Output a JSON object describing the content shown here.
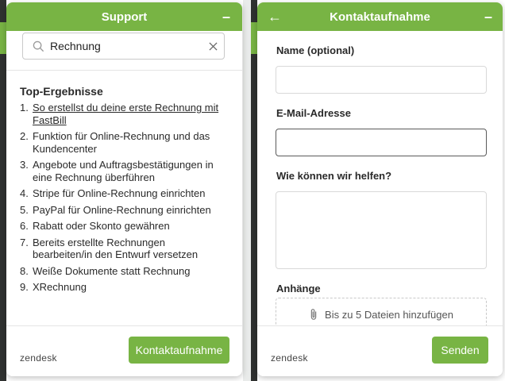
{
  "support_widget": {
    "title": "Support",
    "minimize_symbol": "–",
    "search": {
      "value": "Rechnung",
      "icon": "search-icon",
      "clear_symbol": "×"
    },
    "results_title": "Top-Ergebnisse",
    "results": [
      {
        "number": "1.",
        "text": "So erstellst du deine erste Rechnung mit FastBill"
      },
      {
        "number": "2.",
        "text": "Funktion für Online-Rechnung und das Kundencenter"
      },
      {
        "number": "3.",
        "text": "Angebote und Auftragsbestätigungen in eine Rechnung überführen"
      },
      {
        "number": "4.",
        "text": "Stripe für Online-Rechnung einrichten"
      },
      {
        "number": "5.",
        "text": "PayPal für Online-Rechnung einrichten"
      },
      {
        "number": "6.",
        "text": "Rabatt oder Skonto gewähren"
      },
      {
        "number": "7.",
        "text": "Bereits erstellte Rechnungen bearbeiten/in den Entwurf versetzen"
      },
      {
        "number": "8.",
        "text": "Weiße Dokumente statt Rechnung"
      },
      {
        "number": "9.",
        "text": "XRechnung"
      }
    ],
    "footer": {
      "brand": "zendesk",
      "contact_button": "Kontaktaufnahme"
    }
  },
  "contact_widget": {
    "title": "Kontaktaufnahme",
    "back_symbol": "←",
    "minimize_symbol": "–",
    "name_label": "Name (optional)",
    "name_value": "",
    "email_label": "E-Mail-Adresse",
    "email_value": "",
    "message_label": "Wie können wir helfen?",
    "message_value": "",
    "attachments_label": "Anhänge",
    "attachments_hint": "Bis zu 5 Dateien hinzufügen",
    "footer": {
      "brand": "zendesk",
      "send_button": "Senden"
    }
  },
  "colors": {
    "accent": "#78b444",
    "background_dark": "#2f3130",
    "text": "#2a2a2a"
  }
}
